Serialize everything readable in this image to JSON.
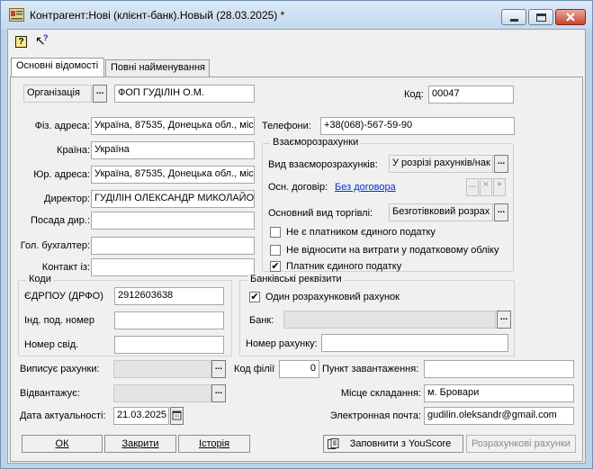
{
  "window": {
    "title": "Контрагент:Нові (клієнт-банк).Новый (28.03.2025) *"
  },
  "toolbar": {
    "help_glyph": "?",
    "whatsthis_glyph": "↖"
  },
  "tabs": [
    {
      "label": "Основні відомості"
    },
    {
      "label": "Повні найменування"
    }
  ],
  "kind": {
    "value": "Організація",
    "name": "ФОП ГУДІЛІН О.М."
  },
  "code": {
    "label": "Код:",
    "value": "00047"
  },
  "left": {
    "phys_addr": {
      "label": "Фіз. адреса:",
      "value": "Україна, 87535, Донецька обл., міс"
    },
    "country": {
      "label": "Країна:",
      "value": "Україна"
    },
    "legal_addr": {
      "label": "Юр. адреса:",
      "value": "Україна, 87535, Донецька обл., міс"
    },
    "director": {
      "label": "Директор:",
      "value": "ГУДІЛІН ОЛЕКСАНДР МИКОЛАЙО"
    },
    "position": {
      "label": "Посада дир.:",
      "value": ""
    },
    "accountant": {
      "label": "Гол. бухгалтер:",
      "value": ""
    },
    "contact": {
      "label": "Контакт із:",
      "value": ""
    }
  },
  "phones": {
    "label": "Телефони:",
    "value": "+38(068)-567-59-90"
  },
  "settlements": {
    "title": "Взаєморозрахунки",
    "kind_label": "Вид взаєморозрахунків:",
    "kind_value": "У розрізі рахунків/нак",
    "contract_label": "Осн. договір:",
    "contract_link": "Без договора",
    "trade_label": "Основний вид торгівлі:",
    "trade_value": "Безготівковий розрах",
    "checks": [
      {
        "label": "Не є платником єдиного податку",
        "checked": false
      },
      {
        "label": "Не відносити на витрати у податковому обліку",
        "checked": false
      },
      {
        "label": "Платник єдиного податку",
        "checked": true
      }
    ]
  },
  "codes": {
    "title": "Коди",
    "edrpou_label": "ЄДРПОУ (ДРФО)",
    "edrpou_value": "2912603638",
    "ind_label": "Інд. под. номер",
    "ind_value": "",
    "cert_label": "Номер свід.",
    "cert_value": ""
  },
  "bank": {
    "title": "Банківські реквізити",
    "single_label": "Один розрахунковий рахунок",
    "single_checked": true,
    "bank_label": "Банк:",
    "bank_value": "",
    "account_label": "Номер рахунку:",
    "account_value": ""
  },
  "bottom": {
    "issues_label": "Виписує рахунки:",
    "issues_value": "",
    "ships_label": "Відвантажує:",
    "ships_value": "",
    "date_label": "Дата актуальності:",
    "date_value": "21.03.2025",
    "branch_label": "Код філії",
    "branch_value": "0",
    "loading_label": "Пункт завантаження:",
    "loading_value": "",
    "place_label": "Місце складання:",
    "place_value": "м. Бровари",
    "email_label": "Электронная почта:",
    "email_value": "gudilin.oleksandr@gmail.com"
  },
  "buttons": {
    "ok": "ОК",
    "close": "Закрити",
    "history": "Історія",
    "youscore": "Заповнити з YouScore",
    "accounts": "Розрахункові рахунки"
  },
  "icons": {
    "app": "contractor-card-icon",
    "help": "help-icon",
    "whatsthis": "whats-this-icon",
    "youscore": "youscore-icon",
    "calendar": "calendar-icon"
  }
}
